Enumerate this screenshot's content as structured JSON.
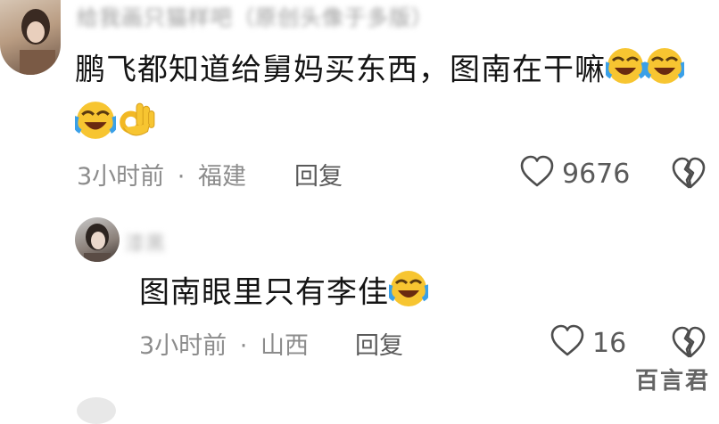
{
  "comments": [
    {
      "username": "给我画只猫样吧（原创头像于多版）",
      "text": "鹏飞都知道给舅妈买东西，图南在干嘛",
      "emoji_inline": [
        "laughing-crying-emoji",
        "laughing-crying-emoji"
      ],
      "emoji_line2": [
        "laughing-crying-emoji",
        "ok-hand-emoji"
      ],
      "time": "3小时前",
      "location": "福建",
      "reply_label": "回复",
      "likes": "9676"
    },
    {
      "username": "漆黑",
      "text": "图南眼里只有李佳",
      "emoji_inline": [
        "laughing-crying-emoji"
      ],
      "time": "3小时前",
      "location": "山西",
      "reply_label": "回复",
      "likes": "16"
    }
  ],
  "meta_separator": "·",
  "watermark": "百言君",
  "colors": {
    "text": "#141414",
    "meta": "#8c8c8c",
    "icon_stroke": "#4d4d4d",
    "emoji_yellow": "#f7c531"
  }
}
